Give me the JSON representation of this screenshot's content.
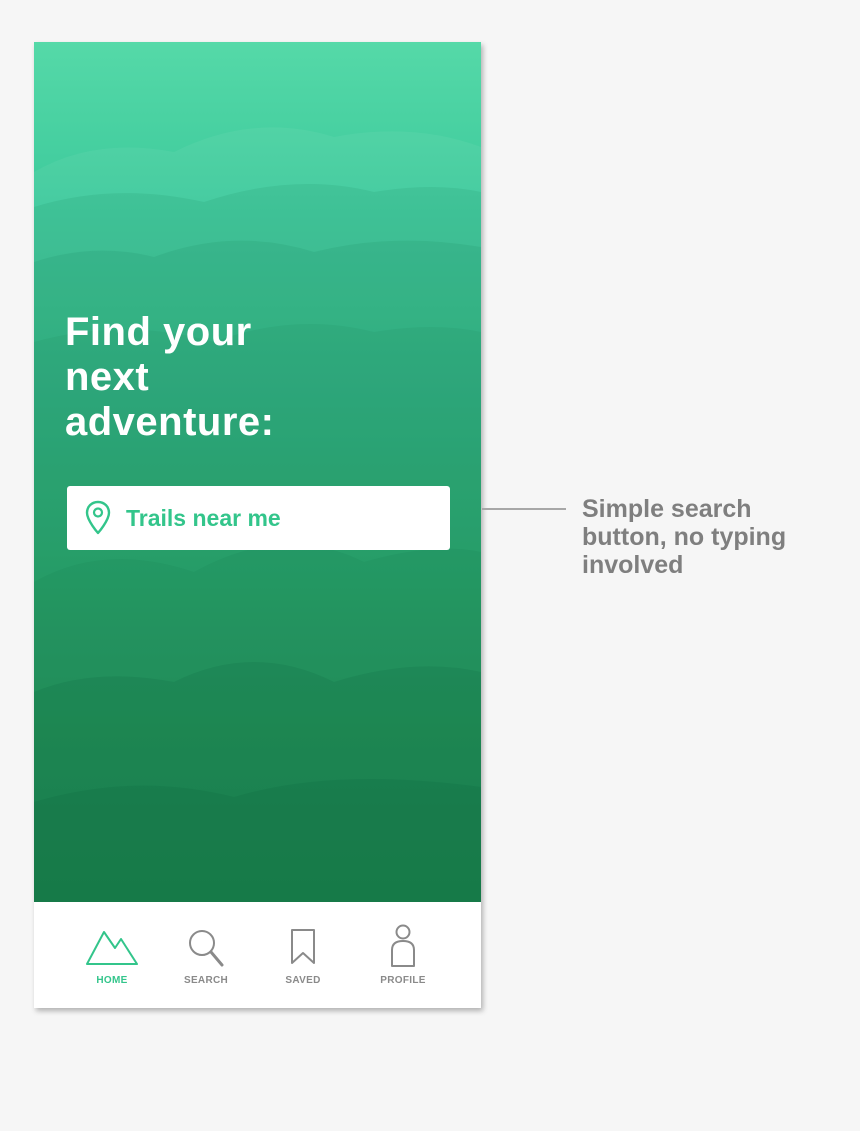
{
  "hero": {
    "headline": "Find your\nnext\nadventure:"
  },
  "search_button": {
    "label": "Trails near me",
    "icon": "location-pin-icon"
  },
  "tab_bar": {
    "active_color": "#33c58b",
    "inactive_color": "#8a8a8a",
    "items": [
      {
        "label": "HOME",
        "icon": "mountain-icon",
        "active": true
      },
      {
        "label": "SEARCH",
        "icon": "magnifier-icon",
        "active": false
      },
      {
        "label": "SAVED",
        "icon": "bookmark-icon",
        "active": false
      },
      {
        "label": "PROFILE",
        "icon": "person-icon",
        "active": false
      }
    ]
  },
  "annotation": {
    "text": "Simple search\nbutton, no typing\ninvolved"
  },
  "colors": {
    "brand_green": "#33c58b",
    "hero_top": "#55d9a8",
    "hero_bottom": "#1e8e4e",
    "annotation_gray": "#7f7f7f"
  }
}
